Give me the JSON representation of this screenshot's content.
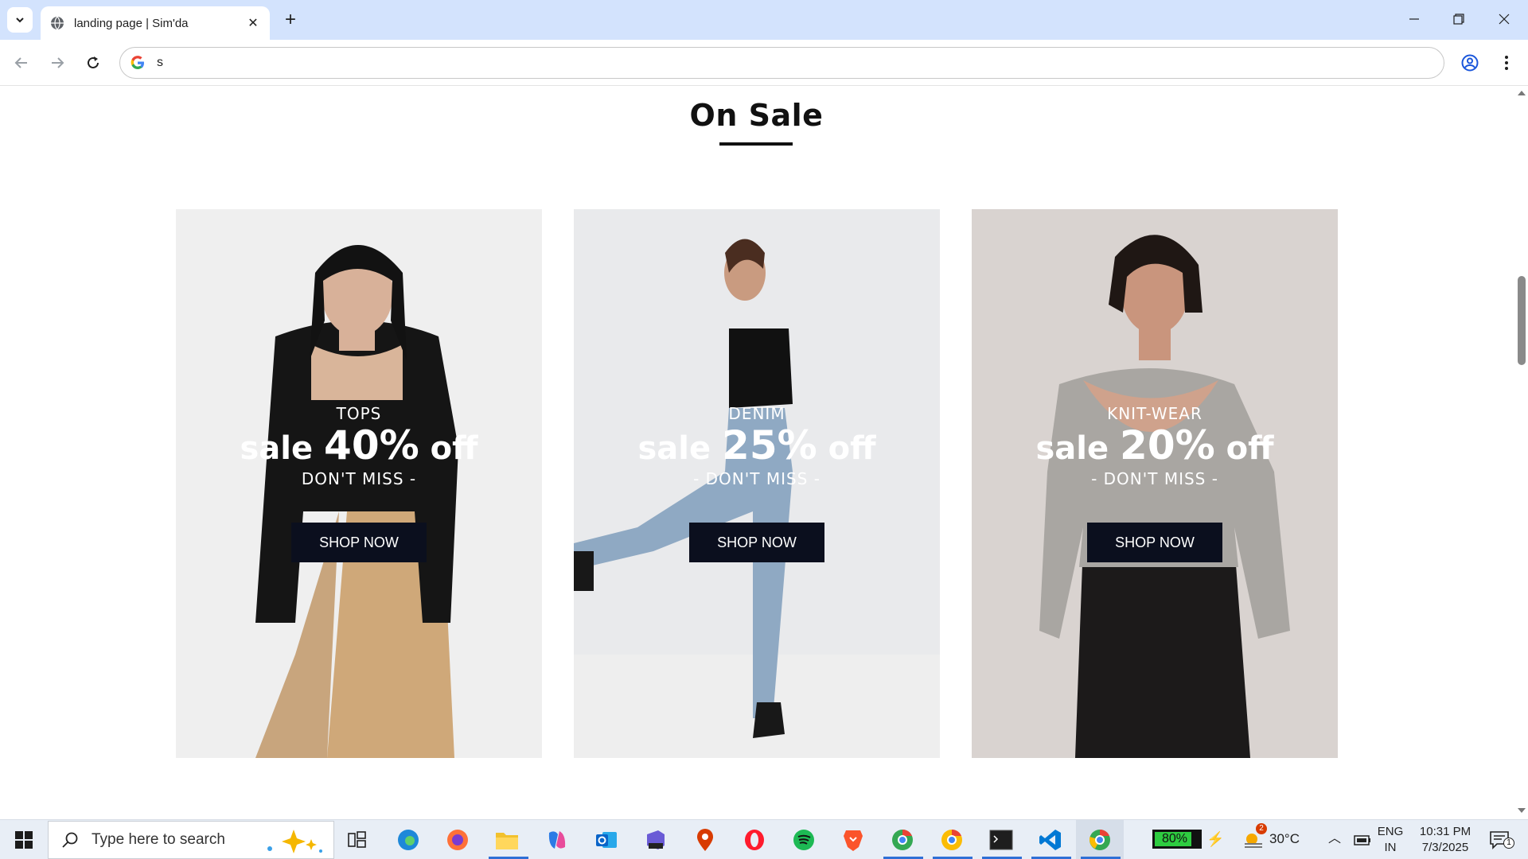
{
  "browser": {
    "tab_title": "landing page | Sim'da",
    "address_value": "s"
  },
  "page": {
    "section_title": "On Sale",
    "cards": [
      {
        "category": "TOPS",
        "sale_prefix": "sale",
        "percent": "40%",
        "sale_suffix": "off",
        "tagline": "DON'T MISS -",
        "button_label": "SHOP NOW"
      },
      {
        "category": "DENIM",
        "sale_prefix": "sale",
        "percent": "25%",
        "sale_suffix": "off",
        "tagline": "- DON'T MISS -",
        "button_label": "SHOP NOW"
      },
      {
        "category": "KNIT-WEAR",
        "sale_prefix": "sale",
        "percent": "20%",
        "sale_suffix": "off",
        "tagline": "- DON'T MISS -",
        "button_label": "SHOP NOW"
      }
    ]
  },
  "taskbar": {
    "search_placeholder": "Type here to search",
    "battery": "80%",
    "weather_badge": "2",
    "temperature": "30°C",
    "lang_line1": "ENG",
    "lang_line2": "IN",
    "time": "10:31 PM",
    "date": "7/3/2025",
    "notification_count": "1"
  },
  "colors": {
    "chrome_frame": "#d3e3fd",
    "shop_button": "#0b0f1e",
    "taskbar": "#e8eef6"
  },
  "icons": [
    "tab-list-icon",
    "globe-icon",
    "close-icon",
    "new-tab-icon",
    "minimize-icon",
    "maximize-icon",
    "window-close-icon",
    "back-icon",
    "forward-icon",
    "reload-icon",
    "google-icon",
    "profile-icon",
    "menu-icon",
    "windows-start-icon",
    "search-icon",
    "task-view-icon",
    "edge-icon",
    "firefox-icon",
    "file-explorer-icon",
    "copilot-icon",
    "outlook-icon",
    "m365-icon",
    "maps-icon",
    "opera-icon",
    "spotify-icon",
    "brave-icon",
    "chrome-icon",
    "terminal-icon",
    "vscode-icon",
    "battery-icon",
    "weather-icon",
    "notification-icon"
  ]
}
